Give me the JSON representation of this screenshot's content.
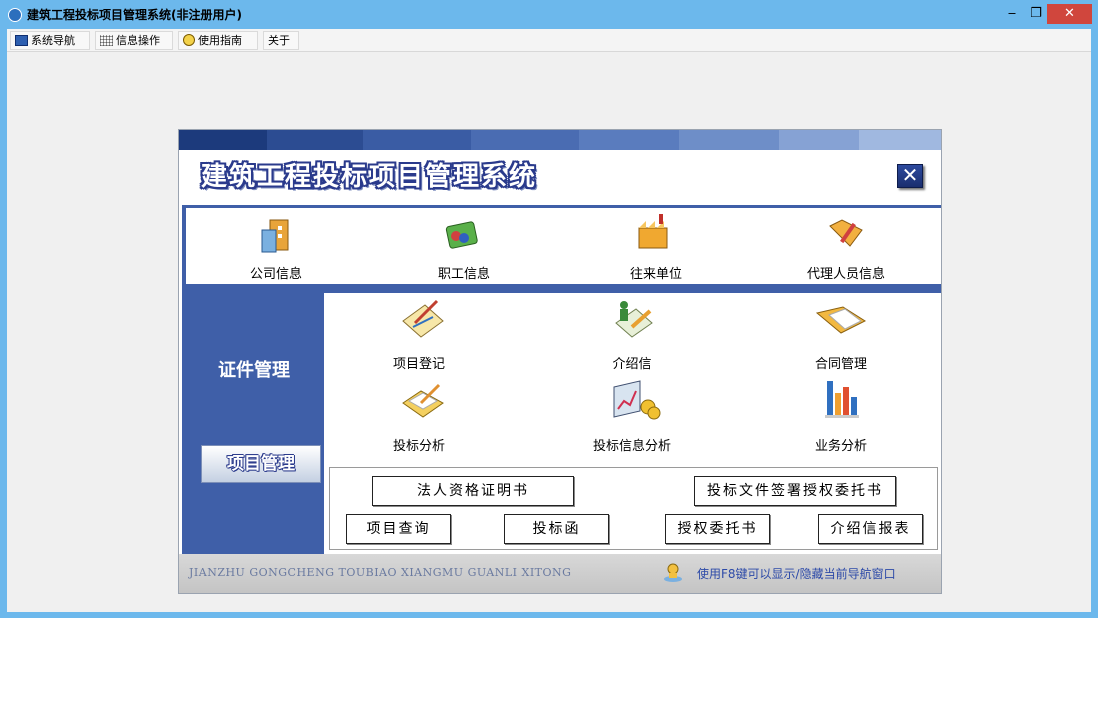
{
  "window": {
    "title": "建筑工程投标项目管理系统(非注册用户)",
    "controls": {
      "minimize": "‒",
      "restore": "❐",
      "close": "✕"
    }
  },
  "menubar": {
    "items": [
      {
        "label": "系统导航",
        "icon": "monitor-icon"
      },
      {
        "label": "信息操作",
        "icon": "grid-icon"
      },
      {
        "label": "使用指南",
        "icon": "smiley-icon"
      },
      {
        "label": "关于"
      }
    ]
  },
  "nav": {
    "title": "建筑工程投标项目管理系统",
    "close_glyph": "✕",
    "top_items": [
      {
        "label": "公司信息",
        "icon": "company-icon"
      },
      {
        "label": "职工信息",
        "icon": "staff-icon"
      },
      {
        "label": "往来单位",
        "icon": "factory-icon"
      },
      {
        "label": "代理人员信息",
        "icon": "agent-folder-icon"
      }
    ],
    "section_title": "证件管理",
    "project_button": "项目管理",
    "grid_items": [
      {
        "label": "项目登记",
        "icon": "register-icon"
      },
      {
        "label": "介绍信",
        "icon": "letter-icon"
      },
      {
        "label": "合同管理",
        "icon": "contract-icon"
      },
      {
        "label": "投标分析",
        "icon": "bid-analysis-icon"
      },
      {
        "label": "投标信息分析",
        "icon": "bid-info-chart-icon"
      },
      {
        "label": "业务分析",
        "icon": "bar-chart-icon"
      }
    ],
    "doc_buttons": {
      "legal_cert": "法人资格证明书",
      "bid_auth": "投标文件签署授权委托书",
      "project_query": "项目查询",
      "bid_letter": "投标函",
      "auth_letter": "授权委托书",
      "intro_report": "介绍信报表"
    },
    "footer_pinyin": "JIANZHU GONGCHENG TOUBIAO XIANGMU GUANLI XITONG",
    "footer_hint": "使用F8键可以显示/隐藏当前导航窗口"
  },
  "colors": {
    "titlebar": "#6cb8ec",
    "close_button": "#d0463d",
    "nav_blue": "#3f5fa8",
    "hint_text": "#2d4aa8"
  }
}
